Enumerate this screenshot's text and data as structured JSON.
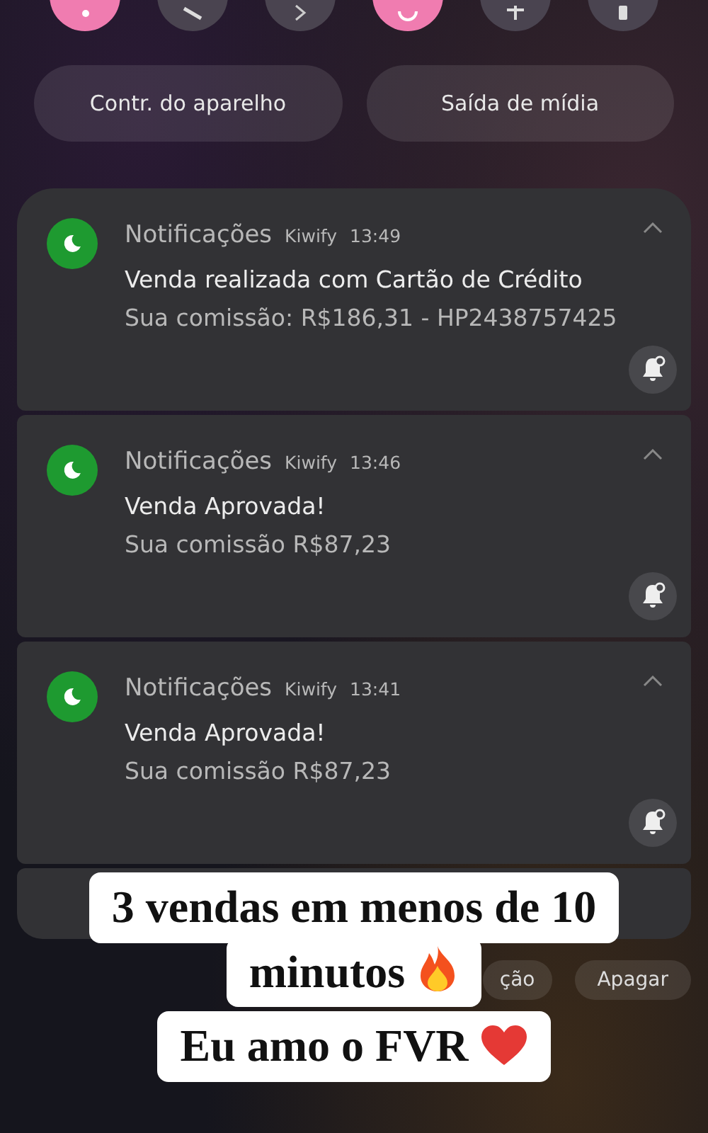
{
  "quick_toggles": [
    {
      "on": true
    },
    {
      "on": false
    },
    {
      "on": false
    },
    {
      "on": true
    },
    {
      "on": false
    },
    {
      "on": false
    }
  ],
  "panel_buttons": [
    "Contr. do aparelho",
    "Saída de mídia"
  ],
  "notifications": [
    {
      "app": "Notificações",
      "source": "Kiwify",
      "time": "13:49",
      "title": "Venda realizada com Cartão de Crédito",
      "body": "Sua comissão: R$186,31 - HP2438757425"
    },
    {
      "app": "Notificações",
      "source": "Kiwify",
      "time": "13:46",
      "title": "Venda Aprovada!",
      "body": "Sua comissão R$87,23"
    },
    {
      "app": "Notificações",
      "source": "Kiwify",
      "time": "13:41",
      "title": "Venda Aprovada!",
      "body": "Sua comissão R$87,23"
    }
  ],
  "footer_buttons": [
    "ção",
    "Apagar"
  ],
  "captions": [
    {
      "lines": [
        "3 vendas em menos de 10",
        "minutos"
      ]
    },
    {
      "lines": [
        "Eu amo o FVR"
      ]
    }
  ]
}
